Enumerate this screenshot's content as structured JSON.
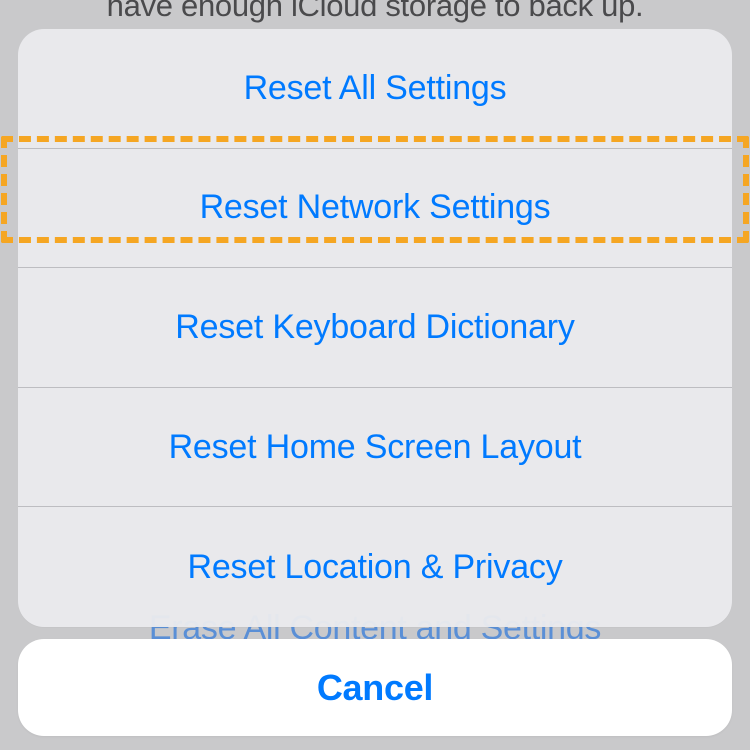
{
  "background": {
    "partial_text_top": "have enough iCloud storage to back up.",
    "partial_option_behind": "Erase All Content and Settings"
  },
  "action_sheet": {
    "options": [
      {
        "label": "Reset All Settings"
      },
      {
        "label": "Reset Network Settings",
        "highlighted": true
      },
      {
        "label": "Reset Keyboard Dictionary"
      },
      {
        "label": "Reset Home Screen Layout"
      },
      {
        "label": "Reset Location & Privacy"
      }
    ],
    "cancel_label": "Cancel"
  },
  "annotation": {
    "highlight_color": "#f5a623",
    "highlighted_option_index": 1
  }
}
